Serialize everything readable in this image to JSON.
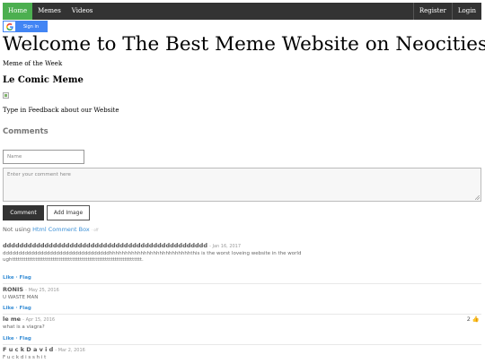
{
  "nav": {
    "items": [
      {
        "label": "Home",
        "active": true
      },
      {
        "label": "Memes",
        "active": false
      },
      {
        "label": "Videos",
        "active": false
      }
    ],
    "right_items": [
      {
        "label": "Register"
      },
      {
        "label": "Login"
      }
    ]
  },
  "signin": {
    "label": "Sign in",
    "icon": "google-g-icon"
  },
  "page": {
    "title": "Welcome to The Best Meme Website on Neocities!",
    "meme_of_week": "Meme of the Week",
    "comic_title": "Le Comic Meme",
    "feedback_prompt": "Type in Feedback about our Website"
  },
  "comment_box": {
    "heading": "Comments",
    "name_placeholder": "Name",
    "comment_placeholder": "Enter your comment here",
    "comment_button": "Comment",
    "add_image_button": "Add Image",
    "not_using_text": "Not using",
    "service_link": "Html Comment Box",
    "service_suffix": "· off"
  },
  "comments": [
    {
      "name": "ddddddddddddddddddddddddddddddddddddddddddddddddd",
      "date": "Jan 16, 2017",
      "body_lines": [
        "ddddddddddddddddddddddddddddddddddhhhhhhhhhhhhhhhhhhhhhhhhhhthis is the worst loveing website in the world",
        "ughttttttttttttttttttttttttttttttttttttttttttttttttttttttttttttttttttt."
      ],
      "actions": "Like · Flag",
      "votes": ""
    },
    {
      "name": "RONIS",
      "date": "May 25, 2016",
      "body_lines": [
        "U WASTE MAN"
      ],
      "actions": "Like · Flag",
      "votes": ""
    },
    {
      "name": "le me",
      "date": "Apr 15, 2016",
      "body_lines": [
        "what is a viagra?"
      ],
      "actions": "Like · Flag",
      "votes": "2"
    },
    {
      "name": "F u c k D a v i d",
      "date": "Mar 2, 2016",
      "body_lines": [
        "F u c k d i s s h i t"
      ],
      "actions": "",
      "votes": ""
    }
  ],
  "colors": {
    "nav_bg": "#333333",
    "nav_active": "#4caf50",
    "google_blue": "#4285f4",
    "link": "#3a8fd6"
  }
}
